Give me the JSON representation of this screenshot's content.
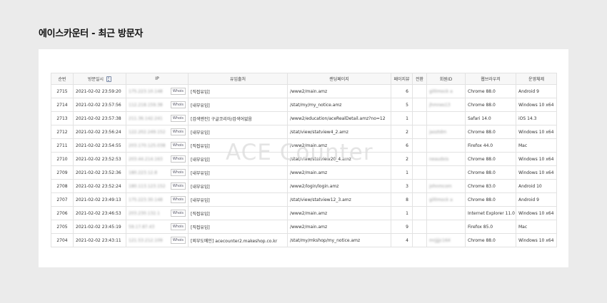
{
  "page": {
    "title": "에이스카운터 - 최근 방문자"
  },
  "watermark": "ACE Counter",
  "whois_label": "Whois",
  "table": {
    "headers": [
      "순번",
      "방문일시",
      "IP",
      "유입출처",
      "랜딩페이지",
      "페이지뷰",
      "전환",
      "회원ID",
      "웹브라우저",
      "운영체제"
    ],
    "rows": [
      {
        "no": "2715",
        "date": "2021-02-02 23:59:20",
        "ip": "175.223.10.148",
        "source": "[직접유입]",
        "landing": "/www2/main.amz",
        "pv": "6",
        "conv": "",
        "member": "gil0mock a",
        "browser": "Chrome 88.0",
        "os": "Android 9"
      },
      {
        "no": "2714",
        "date": "2021-02-02 23:57:56",
        "ip": "112.218.159.38",
        "source": "[내부유입]",
        "landing": "/stat/my/my_notice.amz",
        "pv": "5",
        "conv": "",
        "member": "jhmnes13",
        "browser": "Chrome 88.0",
        "os": "Windows 10 x64"
      },
      {
        "no": "2713",
        "date": "2021-02-02 23:57:38",
        "ip": "211.36.142.241",
        "source": "[검색엔진] 구글코리아/검색어없음",
        "landing": "/www2/education/aceRealDetail.amz?no=12",
        "pv": "1",
        "conv": "",
        "member": "",
        "browser": "Safari 14.0",
        "os": "iOS 14.3"
      },
      {
        "no": "2712",
        "date": "2021-02-02 23:56:24",
        "ip": "122.202.249.152",
        "source": "[내부유입]",
        "landing": "/stat/view/statview4_2.amz",
        "pv": "2",
        "conv": "",
        "member": "jaoztdm",
        "browser": "Chrome 88.0",
        "os": "Windows 10 x64"
      },
      {
        "no": "2711",
        "date": "2021-02-02 23:54:55",
        "ip": "203.170.125.038",
        "source": "[직접유입]",
        "landing": "/www2/main.amz",
        "pv": "6",
        "conv": "",
        "member": "",
        "browser": "Firefox 44.0",
        "os": "Mac"
      },
      {
        "no": "2710",
        "date": "2021-02-02 23:52:53",
        "ip": "203.44.214.163",
        "source": "[내부유입]",
        "landing": "/stat/view/statview20_4.amz",
        "pv": "2",
        "conv": "",
        "member": "neaudxis",
        "browser": "Chrome 88.0",
        "os": "Windows 10 x64"
      },
      {
        "no": "2709",
        "date": "2021-02-02 23:52:36",
        "ip": "180.223.12.8",
        "source": "[내부유입]",
        "landing": "/www2/main.amz",
        "pv": "1",
        "conv": "",
        "member": "",
        "browser": "Chrome 88.0",
        "os": "Windows 10 x64"
      },
      {
        "no": "2708",
        "date": "2021-02-02 23:52:24",
        "ip": "180.113.123.152",
        "source": "[내부유입]",
        "landing": "/www2/login/login.amz",
        "pv": "3",
        "conv": "",
        "member": "johnmcom",
        "browser": "Chrome 83.0",
        "os": "Android 10"
      },
      {
        "no": "2707",
        "date": "2021-02-02 23:49:13",
        "ip": "175.223.30.148",
        "source": "[내부유입]",
        "landing": "/stat/view/statview12_3.amz",
        "pv": "8",
        "conv": "",
        "member": "gil0mock a",
        "browser": "Chrome 88.0",
        "os": "Android 9"
      },
      {
        "no": "2706",
        "date": "2021-02-02 23:46:53",
        "ip": "203.230.132.1",
        "source": "[직접유입]",
        "landing": "/www2/main.amz",
        "pv": "1",
        "conv": "",
        "member": "",
        "browser": "Internet Explorer 11.0",
        "os": "Windows 10 x64"
      },
      {
        "no": "2705",
        "date": "2021-02-02 23:45:19",
        "ip": "59.17.87.43",
        "source": "[직접유입]",
        "landing": "/www2/main.amz",
        "pv": "9",
        "conv": "",
        "member": "",
        "browser": "Firefox 85.0",
        "os": "Mac"
      },
      {
        "no": "2704",
        "date": "2021-02-02 23:43:11",
        "ip": "121.53.212.109",
        "source": "[외부도메인] acecounter2.makeshop.co.kr",
        "landing": "/stat/my/mkshop/my_notice.amz",
        "pv": "4",
        "conv": "",
        "member": "mrjjjjc164",
        "browser": "Chrome 88.0",
        "os": "Windows 10 x64"
      }
    ]
  }
}
